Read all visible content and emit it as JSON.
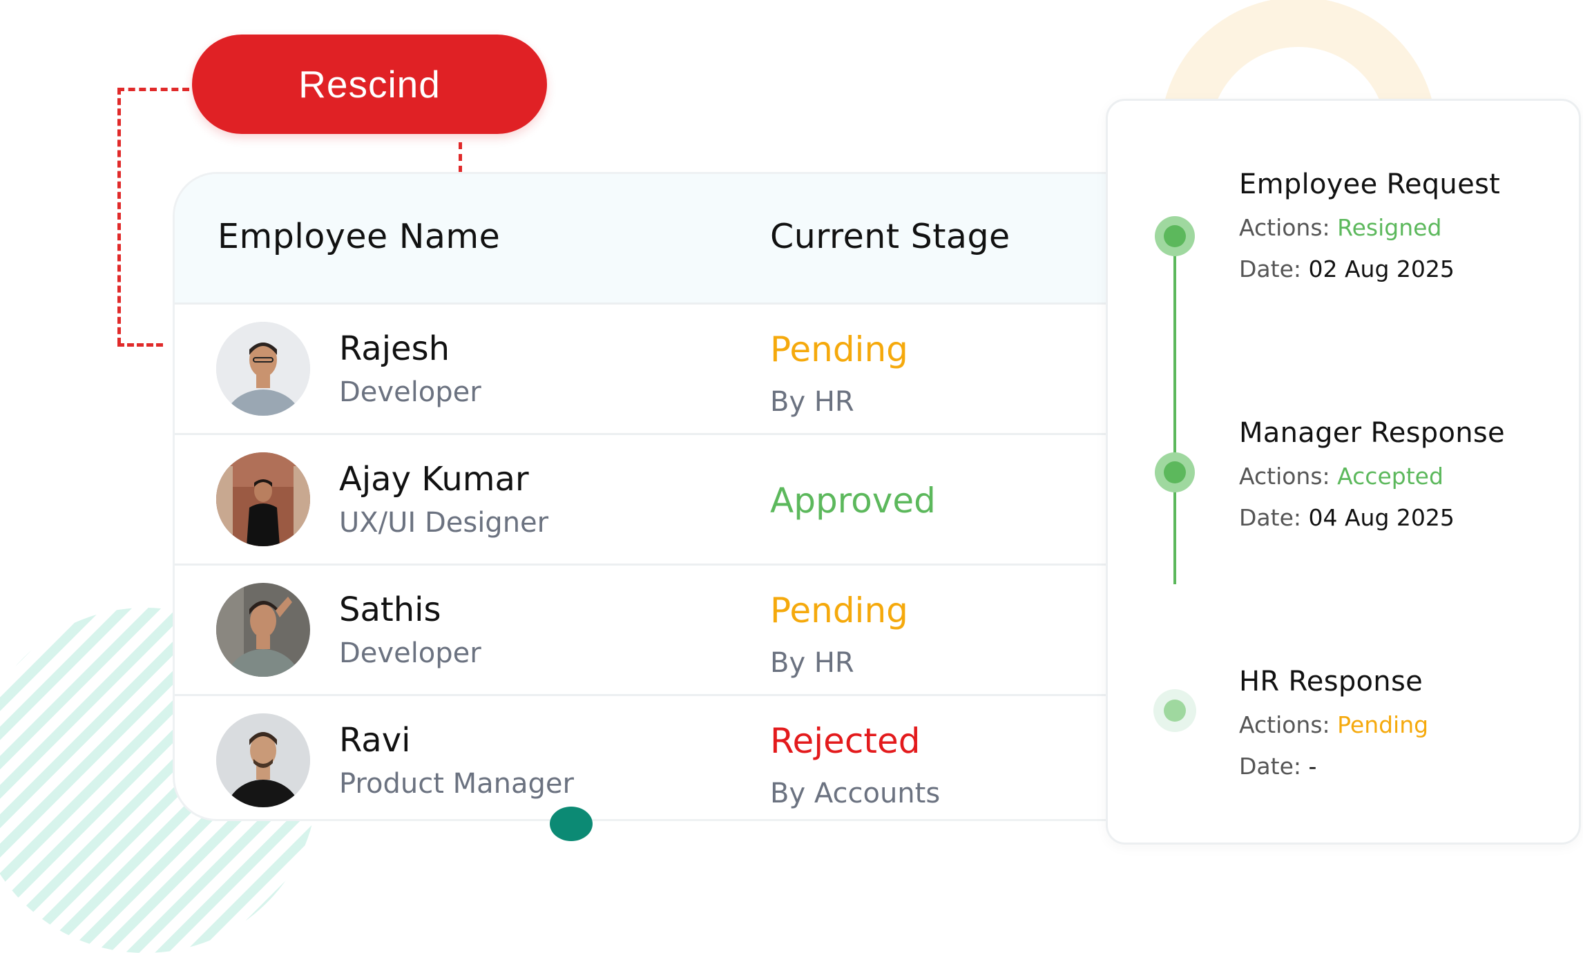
{
  "rescind_button": {
    "label": "Rescind"
  },
  "table": {
    "headers": {
      "name": "Employee Name",
      "stage": "Current Stage"
    },
    "rows": [
      {
        "name": "Rajesh",
        "role": "Developer",
        "stage": "Pending",
        "stage_by": "By HR",
        "stage_status": "pending"
      },
      {
        "name": "Ajay Kumar",
        "role": "UX/UI Designer",
        "stage": "Approved",
        "stage_by": "",
        "stage_status": "approved"
      },
      {
        "name": "Sathis",
        "role": "Developer",
        "stage": "Pending",
        "stage_by": "By HR",
        "stage_status": "pending"
      },
      {
        "name": "Ravi",
        "role": "Product Manager",
        "stage": "Rejected",
        "stage_by": "By Accounts",
        "stage_status": "rejected"
      }
    ]
  },
  "timeline": {
    "steps": [
      {
        "title": "Employee Request",
        "actions_label": "Actions:",
        "actions_value": "Resigned",
        "date_label": "Date:",
        "date_value": "02 Aug 2025"
      },
      {
        "title": "Manager Response",
        "actions_label": "Actions:",
        "actions_value": "Accepted",
        "date_label": "Date:",
        "date_value": "04 Aug 2025"
      },
      {
        "title": "HR Response",
        "actions_label": "Actions:",
        "actions_value": "Pending",
        "date_label": "Date:",
        "date_value": "-"
      }
    ]
  },
  "colors": {
    "brand_red": "#e02125",
    "pending": "#f5a90c",
    "approved": "#5cb85c",
    "rejected": "#e31a1c",
    "accent_teal": "#0c8a74"
  }
}
